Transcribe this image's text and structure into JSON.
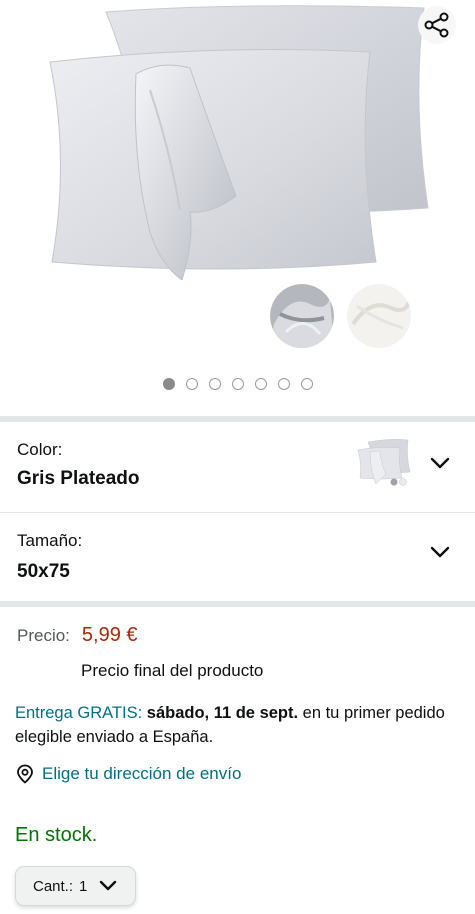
{
  "gallery": {
    "image_count": 7,
    "active_index": 0,
    "share_icon": "share-icon",
    "swatch_colors": [
      "#b9bcc2",
      "#f1f0ec"
    ]
  },
  "variations": {
    "color": {
      "label": "Color:",
      "value": "Gris Plateado"
    },
    "size": {
      "label": "Tamaño:",
      "value": "50x75"
    }
  },
  "price": {
    "label": "Precio:",
    "value": "5,99 €",
    "final_note": "Precio final del producto"
  },
  "delivery": {
    "free_label": "Entrega GRATIS:",
    "date": "sábado, 11 de sept.",
    "rest": " en tu primer pedido elegible enviado a España."
  },
  "address_link": "Elige tu dirección de envío",
  "stock": "En stock.",
  "quantity": {
    "label": "Cant.:",
    "value": "1"
  },
  "colors": {
    "link": "#007185",
    "price": "#b12704",
    "in_stock": "#007600",
    "separator": "#e3e6e6"
  }
}
